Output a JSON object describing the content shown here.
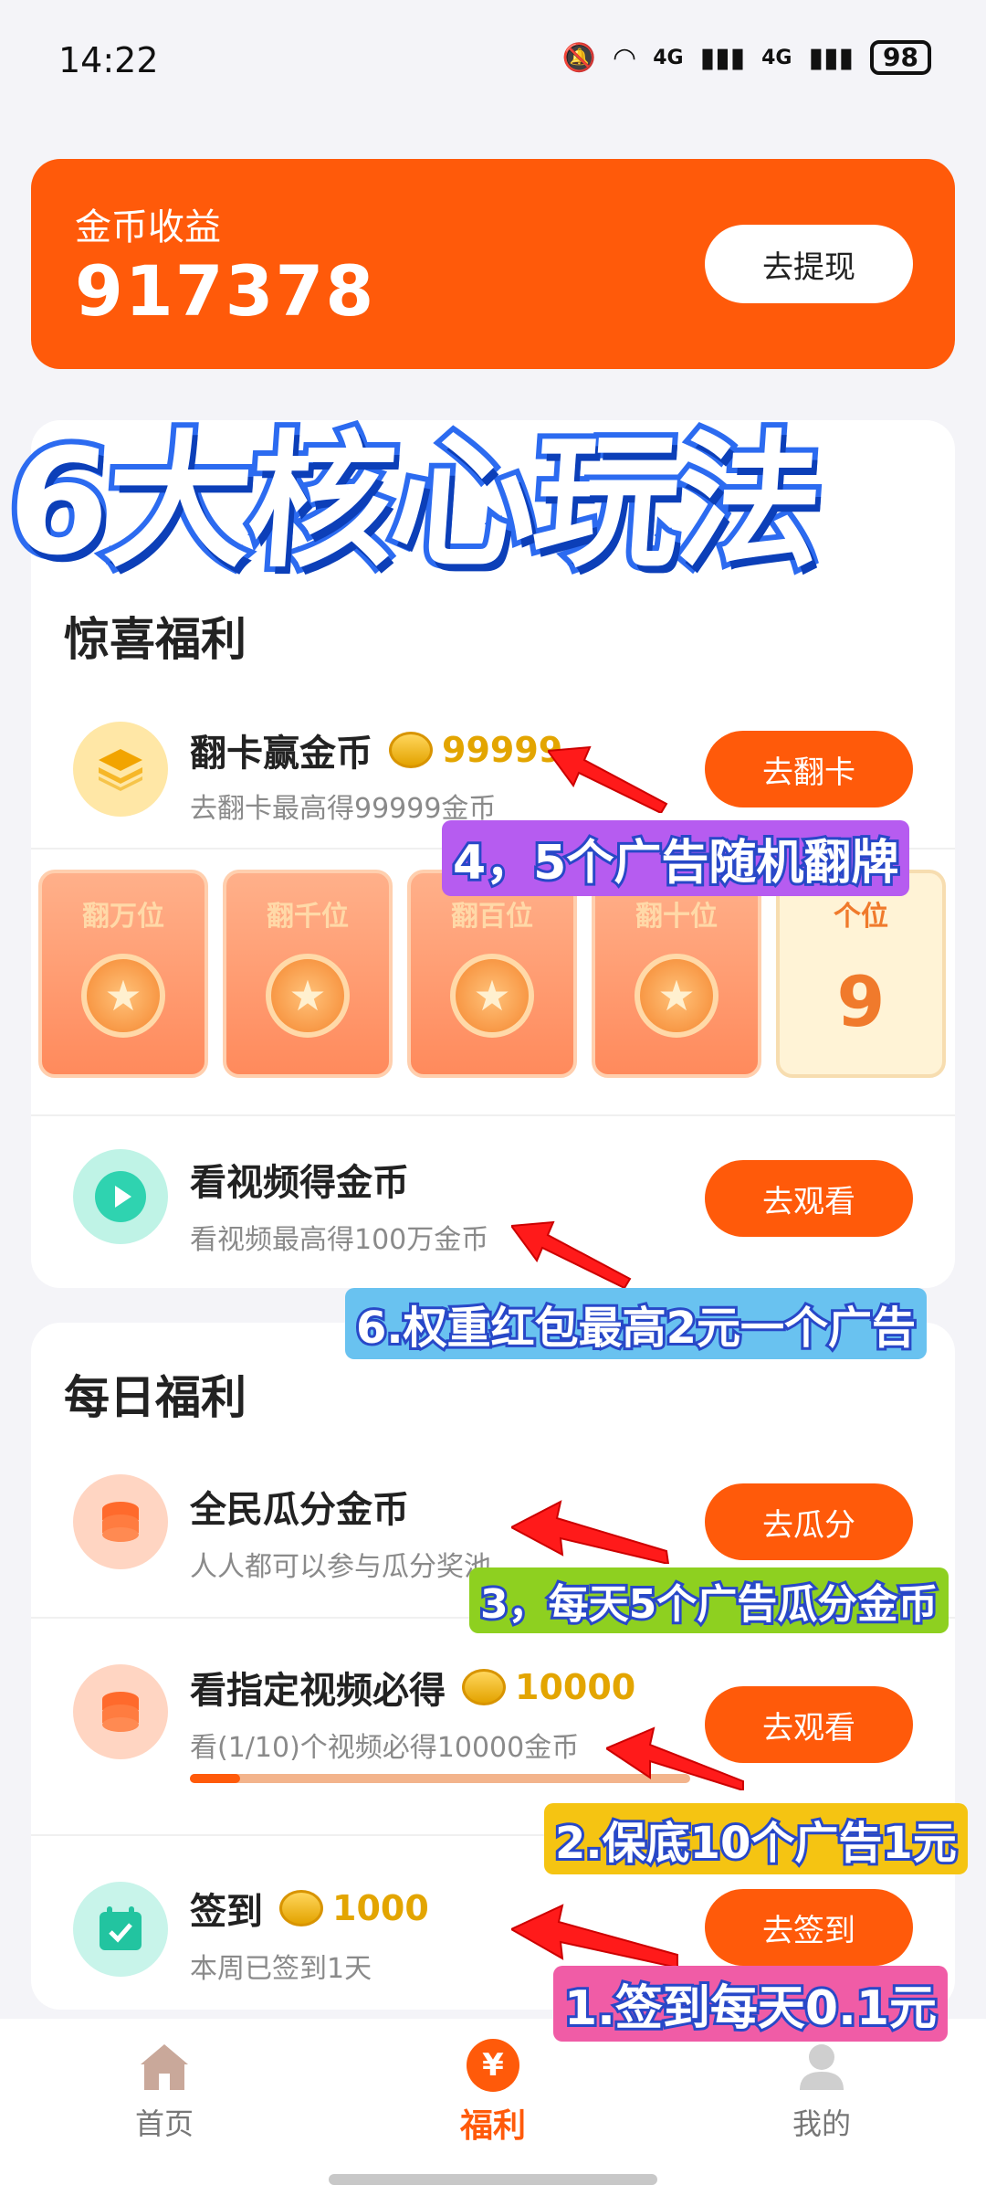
{
  "status_bar": {
    "time": "14:22",
    "network1": "4G",
    "network2": "4G",
    "battery": "98"
  },
  "coin_card": {
    "label": "金币收益",
    "value": "917378",
    "withdraw_label": "去提现"
  },
  "headline": "6大核心玩法",
  "surprise": {
    "title": "惊喜福利",
    "flip": {
      "title": "翻卡赢金币",
      "reward": "99999",
      "sub": "去翻卡最高得99999金币",
      "button": "去翻卡"
    },
    "cards": [
      {
        "label": "翻万位"
      },
      {
        "label": "翻千位"
      },
      {
        "label": "翻百位"
      },
      {
        "label": "翻十位"
      },
      {
        "label": "个位",
        "digit": "9"
      }
    ],
    "video": {
      "title": "看视频得金币",
      "sub": "看视频最高得100万金币",
      "button": "去观看"
    }
  },
  "daily": {
    "title": "每日福利",
    "split": {
      "title": "全民瓜分金币",
      "sub": "人人都可以参与瓜分奖池",
      "button": "去瓜分"
    },
    "specified": {
      "title": "看指定视频必得",
      "reward": "10000",
      "sub": "看(1/10)个视频必得10000金币",
      "button": "去观看",
      "progress": 0.1
    },
    "signin": {
      "title": "签到",
      "reward": "1000",
      "sub": "本周已签到1天",
      "button": "去签到"
    }
  },
  "callouts": {
    "c4": "4，5个广告随机翻牌",
    "c6": "6.权重红包最高2元一个广告",
    "c3": "3，每天5个广告瓜分金币",
    "c2": "2.保底10个广告1元",
    "c1": "1.签到每天0.1元"
  },
  "nav": {
    "home": "首页",
    "welfare": "福利",
    "mine": "我的",
    "welfare_symbol": "¥"
  },
  "colors": {
    "accent": "#ff5a0a",
    "coin": "#e3a500"
  }
}
